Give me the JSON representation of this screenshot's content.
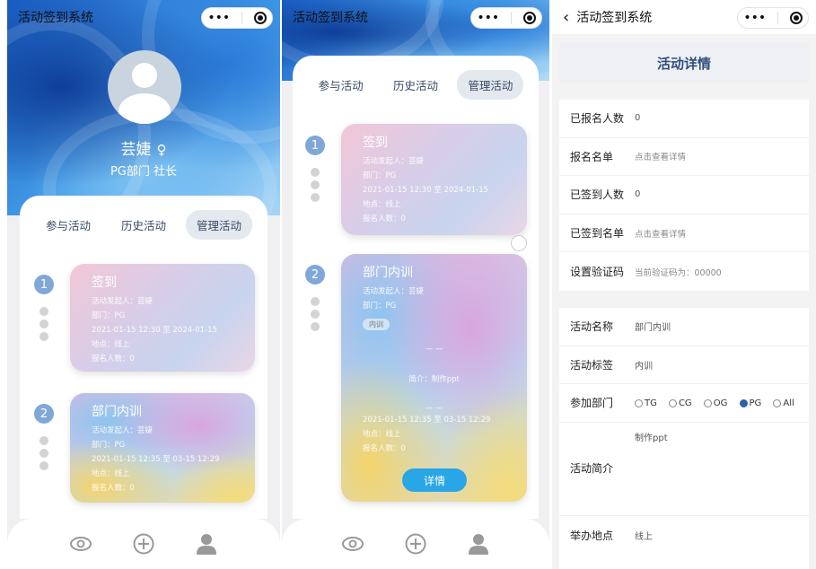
{
  "app_title": "活动签到系统",
  "profile": {
    "name": "芸婕",
    "gender_icon": "♀",
    "role": "PG部门 社长"
  },
  "tabs": [
    "参与活动",
    "历史活动",
    "管理活动"
  ],
  "activities": [
    {
      "index": "1",
      "title": "签到",
      "initiator": "活动发起人：芸婕",
      "dept": "部门：PG",
      "time": "2021-01-15 12:30 至 2024-01-15",
      "location": "地点：线上",
      "count": "报名人数：0"
    },
    {
      "index": "2",
      "title": "部门内训",
      "initiator": "活动发起人：芸婕",
      "dept": "部门：PG",
      "tag": "内训",
      "divider": "— —",
      "intro": "简介：制作ppt",
      "time": "2021-01-15 12:35 至 03-15 12:29",
      "location": "地点：线上",
      "count": "报名人数：0"
    }
  ],
  "detail_button": "详情",
  "nav_icons": [
    "eye-icon",
    "plus-circle-icon",
    "user-icon"
  ],
  "detail": {
    "title": "活动详情",
    "stats": [
      {
        "label": "已报名人数",
        "value": "0",
        "gray": false
      },
      {
        "label": "报名名单",
        "value": "点击查看详情",
        "gray": true
      },
      {
        "label": "已签到人数",
        "value": "0",
        "gray": false
      },
      {
        "label": "已签到名单",
        "value": "点击查看详情",
        "gray": true
      },
      {
        "label": "设置验证码",
        "value": "当前验证码为：00000",
        "gray": true
      }
    ],
    "name_label": "活动名称",
    "name_value": "部门内训",
    "tag_label": "活动标签",
    "tag_value": "内训",
    "dept_label": "参加部门",
    "dept_options": [
      {
        "label": "TG",
        "selected": false
      },
      {
        "label": "CG",
        "selected": false
      },
      {
        "label": "OG",
        "selected": false
      },
      {
        "label": "PG",
        "selected": true
      },
      {
        "label": "All",
        "selected": false
      }
    ],
    "intro_label": "活动简介",
    "intro_value": "制作ppt",
    "location_label": "举办地点",
    "location_value": "线上"
  },
  "colors": {
    "accent": "#29a6e6",
    "selected_radio": "#2f5fa8",
    "index_badge": "#7fa8d8"
  }
}
